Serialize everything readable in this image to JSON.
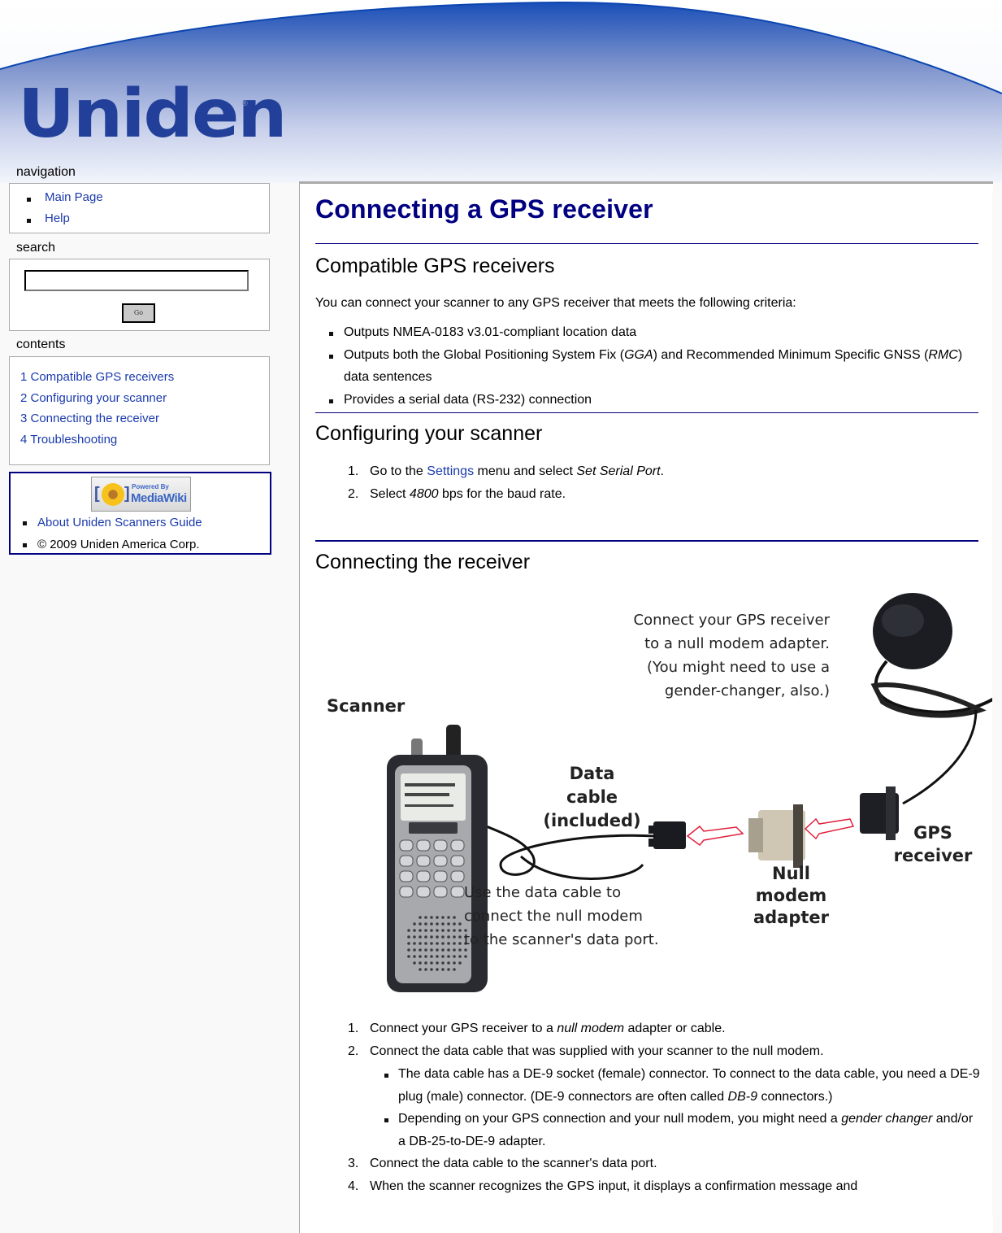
{
  "header": {
    "logo_text": "Uniden",
    "logo_mark": "®",
    "brand_color": "#22409a"
  },
  "sidebar": {
    "navigation": {
      "title": "navigation",
      "items": [
        {
          "label": "Main Page"
        },
        {
          "label": "Help"
        }
      ]
    },
    "search": {
      "title": "search",
      "input_value": "",
      "go_label": "Go"
    },
    "contents": {
      "title": "contents",
      "items": [
        {
          "label": "1 Compatible GPS receivers"
        },
        {
          "label": "2 Configuring your scanner"
        },
        {
          "label": "3 Connecting the receiver"
        },
        {
          "label": "4 Troubleshooting"
        }
      ]
    },
    "footer": {
      "badge_line1": "Powered By",
      "badge_line2": "MediaWiki",
      "links": [
        {
          "label": "About Uniden Scanners Guide"
        },
        {
          "label": "© 2009 Uniden America Corp."
        }
      ]
    }
  },
  "content": {
    "title": "Connecting a GPS receiver",
    "sections": {
      "compatible": {
        "heading": "Compatible GPS receivers",
        "intro": "You can connect your scanner to any GPS receiver that meets the following criteria:",
        "criteria": [
          "Outputs NMEA-0183 v3.01-compliant location data",
          {
            "pre": "Outputs both the Global Positioning System Fix (",
            "em1": "GGA",
            "mid": ") and Recommended Minimum Specific GNSS (",
            "em2": "RMC",
            "post": ") data sentences"
          },
          "Provides a serial data (RS-232) connection"
        ]
      },
      "configuring": {
        "heading": "Configuring your scanner",
        "steps": [
          {
            "num": "1.",
            "pre": "Go to the ",
            "link": "Settings",
            "mid": " menu and select ",
            "em": "Set Serial Port",
            "post": "."
          },
          {
            "num": "2.",
            "pre": "Select ",
            "em": "4800",
            "post": " bps for the baud rate."
          }
        ]
      },
      "connecting": {
        "heading": "Connecting the receiver",
        "diagram": {
          "label_top": [
            "Connect your GPS receiver",
            "to a null modem  adapter.",
            "(You might need to use a",
            "gender-changer, also.)"
          ],
          "label_scanner": "Scanner",
          "label_cable": [
            "Data cable",
            "(included)"
          ],
          "label_use": [
            "Use the data cable to",
            "connect the null modem",
            "to the scanner's data port."
          ],
          "label_null": [
            "Null",
            "modem",
            "adapter"
          ],
          "label_gps": [
            "GPS",
            "receiver"
          ],
          "arrow_color": "#e0203c"
        },
        "steps": [
          {
            "num": "1.",
            "pre": "Connect your GPS receiver to a ",
            "em": "null modem",
            "post": " adapter or cable."
          },
          {
            "num": "2.",
            "text": "Connect the data cable that was supplied with your scanner to the null modem."
          },
          {
            "num": "3.",
            "text": "Connect the data cable to the scanner's data port."
          },
          {
            "num": "4.",
            "text": "When the scanner recognizes the GPS input, it displays a confirmation message and"
          }
        ],
        "substeps": [
          {
            "pre": "The data cable has a DE-9 socket (female) connector. To connect to the data cable, you need a DE-9 plug (male) connector. (DE-9 connectors are often called ",
            "em": "DB-9",
            "post": " connectors.)"
          },
          {
            "pre": "Depending on your GPS connection and your null modem, you might need a ",
            "em": "gender changer",
            "post": " and/or a DB-25-to-DE-9 adapter."
          }
        ]
      }
    }
  }
}
